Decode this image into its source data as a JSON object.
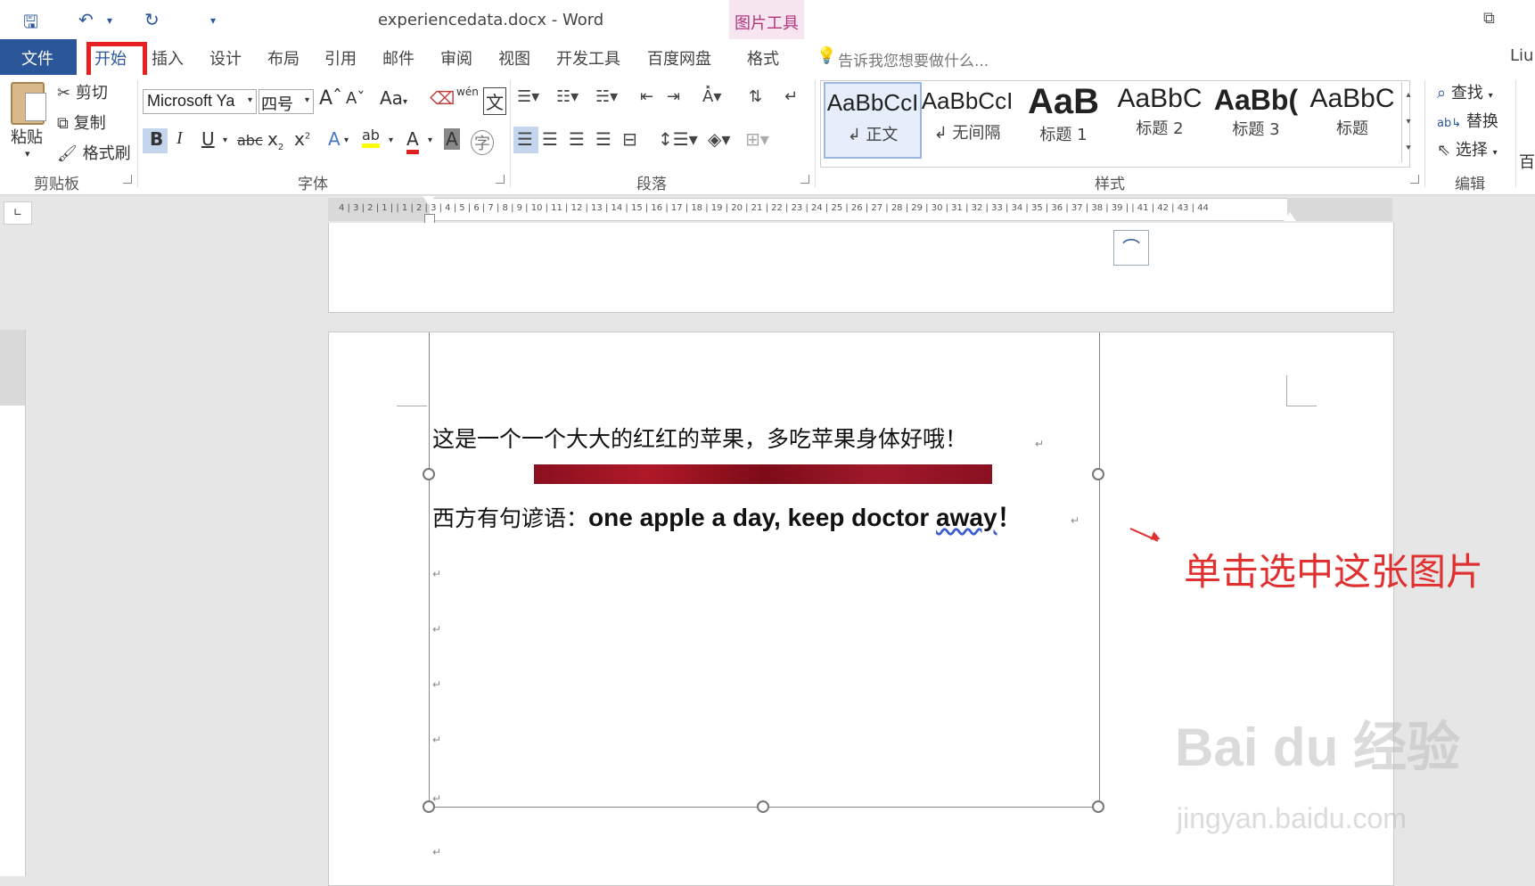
{
  "title_bar": {
    "doc_title": "experiencedata.docx - Word",
    "context_tab_group": "图片工具",
    "user": "Liu,"
  },
  "tabs": [
    "文件",
    "开始",
    "插入",
    "设计",
    "布局",
    "引用",
    "邮件",
    "审阅",
    "视图",
    "开发工具",
    "百度网盘",
    "格式"
  ],
  "tell_me": "告诉我您想要做什么...",
  "clipboard": {
    "paste": "粘贴",
    "cut": "剪切",
    "copy": "复制",
    "format_painter": "格式刷",
    "label": "剪贴板"
  },
  "font": {
    "name": "Microsoft Ya",
    "size": "四号",
    "label": "字体",
    "change_case": "Aa",
    "clear_format": "wén",
    "phonetic": "文"
  },
  "paragraph": {
    "label": "段落"
  },
  "styles": {
    "label": "样式",
    "items": [
      {
        "sample": "AaBbCcI",
        "name": "↲ 正文"
      },
      {
        "sample": "AaBbCcI",
        "name": "↲ 无间隔"
      },
      {
        "sample": "AaB",
        "name": "标题 1"
      },
      {
        "sample": "AaBbC",
        "name": "标题 2"
      },
      {
        "sample": "AaBb(",
        "name": "标题 3"
      },
      {
        "sample": "AaBbC",
        "name": "标题"
      }
    ]
  },
  "editing": {
    "find": "查找",
    "replace": "替换",
    "select": "选择",
    "label": "编辑",
    "cut_off_label": "百"
  },
  "ruler_numbers": "4 | 3 | 2 | 1 |     | 1 | 2 | 3 | 4 | 5 | 6 | 7 | 8 | 9 | 10 | 11 | 12 | 13 | 14 | 15 | 16 | 17 | 18 | 19 | 20 | 21 | 22 | 23 | 24 | 25 | 26 | 27 | 28 | 29 | 30 | 31 | 32 | 33 | 34 | 35 | 36 | 37 | 38 | 39 |     | 41 | 42 | 43 | 44",
  "document": {
    "line1": "这是一个一个大大的红红的苹果，多吃苹果身体好哦！",
    "line2_cn": "西方有句谚语：",
    "line2_en_a": "one apple a day, keep doctor ",
    "line2_en_b": "away",
    "line2_en_c": "！"
  },
  "annotation": "单击选中这张图片",
  "watermark": "Bai du 经验",
  "watermark_url": "jingyan.baidu.com",
  "colors": {
    "word_blue": "#2b579a",
    "annotation_red": "#e03030",
    "context_pink": "#b0357e"
  }
}
